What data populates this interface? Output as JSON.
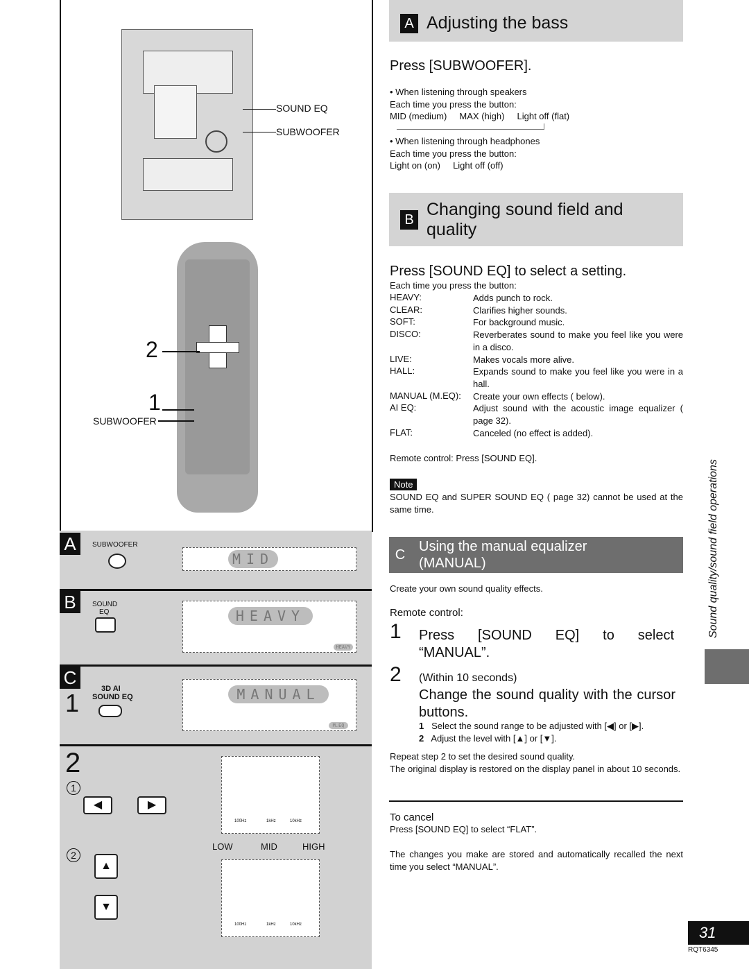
{
  "left": {
    "illustration": {
      "sound_eq_label": "SOUND EQ",
      "subwoofer_label": "SUBWOOFER",
      "step2": "2",
      "step1": "1",
      "remote_subwoofer_label": "SUBWOOFER"
    },
    "panel_a": {
      "letter": "A",
      "button_label": "SUBWOOFER",
      "display": "MID"
    },
    "panel_b": {
      "letter": "B",
      "button_label_1": "SOUND",
      "button_label_2": "EQ",
      "display": "HEAVY",
      "indicator": "HEAVY"
    },
    "panel_c": {
      "letter": "C",
      "step": "1",
      "button_label_1": "3D AI",
      "button_label_2": "SOUND EQ",
      "display": "MANUAL",
      "indicator": "M.EQ"
    },
    "panel_2": {
      "step": "2",
      "sub1": "1",
      "sub2": "2",
      "band_low": "LOW",
      "band_mid": "MID",
      "band_high": "HIGH",
      "freq": [
        "100Hz",
        "1kHz",
        "10kHz"
      ]
    }
  },
  "section_a": {
    "letter": "A",
    "title": "Adjusting the bass",
    "instruction": "Press [SUBWOOFER].",
    "speakers_heading": "When listening through speakers",
    "each_time": "Each time you press the button:",
    "speakers_cycle": [
      "MID (medium)",
      "MAX (high)",
      "Light off (flat)"
    ],
    "headphones_heading": "When listening through headphones",
    "headphones_cycle": [
      "Light on (on)",
      "Light off (off)"
    ]
  },
  "section_b": {
    "letter": "B",
    "title_1": "Changing sound field and",
    "title_2": "quality",
    "instruction": "Press [SOUND EQ] to select a setting.",
    "each_time": "Each time you press the button:",
    "settings": [
      {
        "name": "HEAVY:",
        "desc": "Adds punch to rock."
      },
      {
        "name": "CLEAR:",
        "desc": "Clarifies higher sounds."
      },
      {
        "name": "SOFT:",
        "desc": "For background music."
      },
      {
        "name": "DISCO:",
        "desc": "Reverberates sound to make you feel like you were in a disco."
      },
      {
        "name": "LIVE:",
        "desc": "Makes vocals more alive."
      },
      {
        "name": "HALL:",
        "desc": "Expands sound to make you feel like you were in a hall."
      },
      {
        "name": "MANUAL (M.EQ):",
        "desc": "Create your own effects (    below)."
      },
      {
        "name": "AI EQ:",
        "desc": "Adjust sound with the acoustic image equalizer (    page 32)."
      },
      {
        "name": "FLAT:",
        "desc": "Canceled (no effect is added)."
      }
    ],
    "remote": "Remote control: Press [SOUND EQ].",
    "note_label": "Note",
    "note": "SOUND EQ and SUPER SOUND EQ (     page 32) cannot be used at the same time."
  },
  "section_c": {
    "letter": "C",
    "title_1": "Using the manual equalizer",
    "title_2": "(MANUAL)",
    "intro": "Create your own sound quality effects.",
    "remote": "Remote control:",
    "step1_num": "1",
    "step1_text": "Press [SOUND EQ] to select",
    "step1_text2": "“MANUAL”.",
    "step2_num": "2",
    "step2_pre": "(Within 10 seconds)",
    "step2_text": "Change the sound quality with the cursor buttons.",
    "sub": [
      {
        "n": "1",
        "t": "Select the sound range to be adjusted with [◀] or [▶]."
      },
      {
        "n": "2",
        "t": "Adjust the level with [▲] or [▼]."
      }
    ],
    "repeat": "Repeat step 2 to set the desired sound quality.",
    "restore": "The original display is restored on the display panel in about 10 seconds.",
    "cancel_heading": "To cancel",
    "cancel_text": "Press [SOUND EQ] to select “FLAT”.",
    "stored": "The changes you make are stored and automatically recalled the next time you select “MANUAL”."
  },
  "side_label": "Sound quality/sound field operations",
  "page_number": "31",
  "doc_code": "RQT6345"
}
